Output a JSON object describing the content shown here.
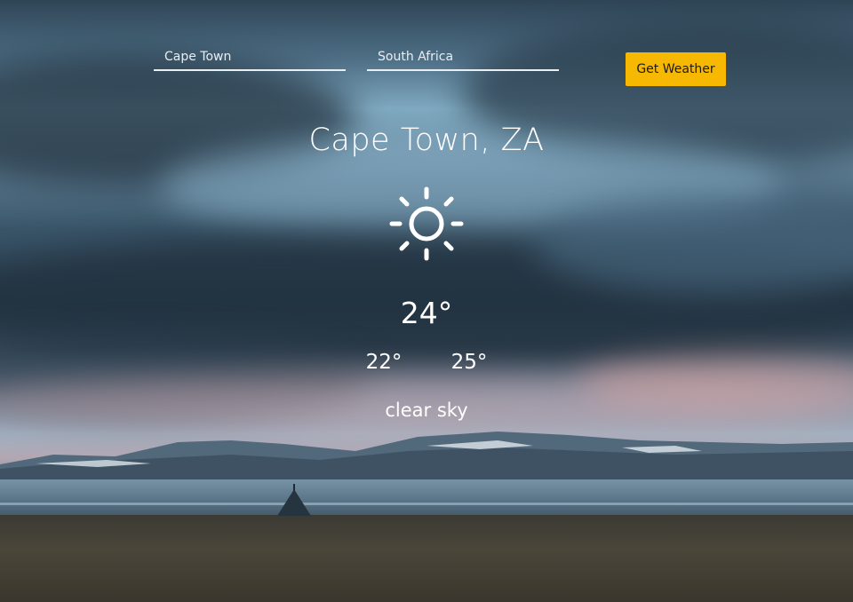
{
  "search": {
    "city_placeholder": "Cape Town",
    "country_placeholder": "South Africa",
    "button_label": "Get Weather"
  },
  "weather": {
    "location": "Cape Town, ZA",
    "icon": "sun-icon",
    "temperature": "24°",
    "min_temperature": "22°",
    "max_temperature": "25°",
    "description": "clear sky"
  },
  "colors": {
    "accent": "#f6b800",
    "text": "#ffffff"
  }
}
